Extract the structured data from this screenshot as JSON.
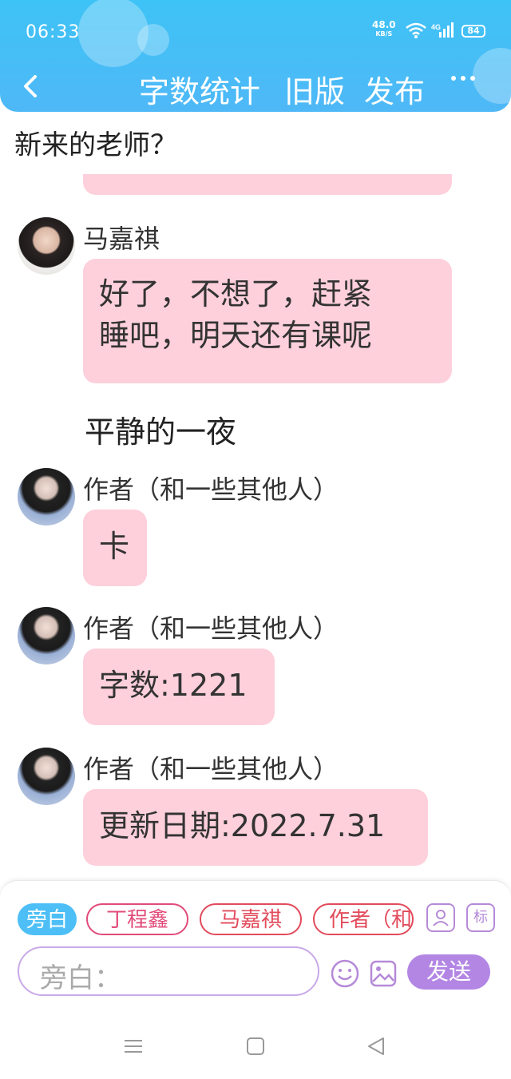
{
  "status_bar": {
    "time": "06:33",
    "net_speed": "48.0",
    "net_unit": "KB/S",
    "signal_label": "4G",
    "battery": "84"
  },
  "nav": {
    "word_count": "字数统计",
    "old_version": "旧版",
    "publish": "发布"
  },
  "chat": {
    "narration_top": "新来的老师？",
    "messages": [
      {
        "sender": "马嘉祺",
        "text": "好了，不想了，赶紧睡吧，明天还有课呢"
      },
      {
        "narration": "平静的一夜"
      },
      {
        "sender": "作者（和一些其他人）",
        "text": "卡"
      },
      {
        "sender": "作者（和一些其他人）",
        "text": "字数:1221"
      },
      {
        "sender": "作者（和一些其他人）",
        "text": "更新日期:2022.7.31"
      }
    ],
    "msg1_line1": "好了，不想了，赶紧",
    "msg1_line2": "睡吧，明天还有课呢"
  },
  "composer": {
    "chips": [
      "旁白",
      "丁程鑫",
      "马嘉祺",
      "作者（和"
    ],
    "biao_label": "标",
    "input_prefix": "旁白：",
    "send_label": "发送"
  },
  "colors": {
    "header": "#3ec3f6",
    "bubble": "#fdd0dc",
    "chip_red": "#e24b5c",
    "send": "#b386e4"
  },
  "icons": [
    "back-icon",
    "more-icon",
    "wifi-icon",
    "signal-icon",
    "battery-icon",
    "contact-icon",
    "emoji-icon",
    "image-icon",
    "menu-icon",
    "home-icon",
    "back-triangle-icon"
  ]
}
